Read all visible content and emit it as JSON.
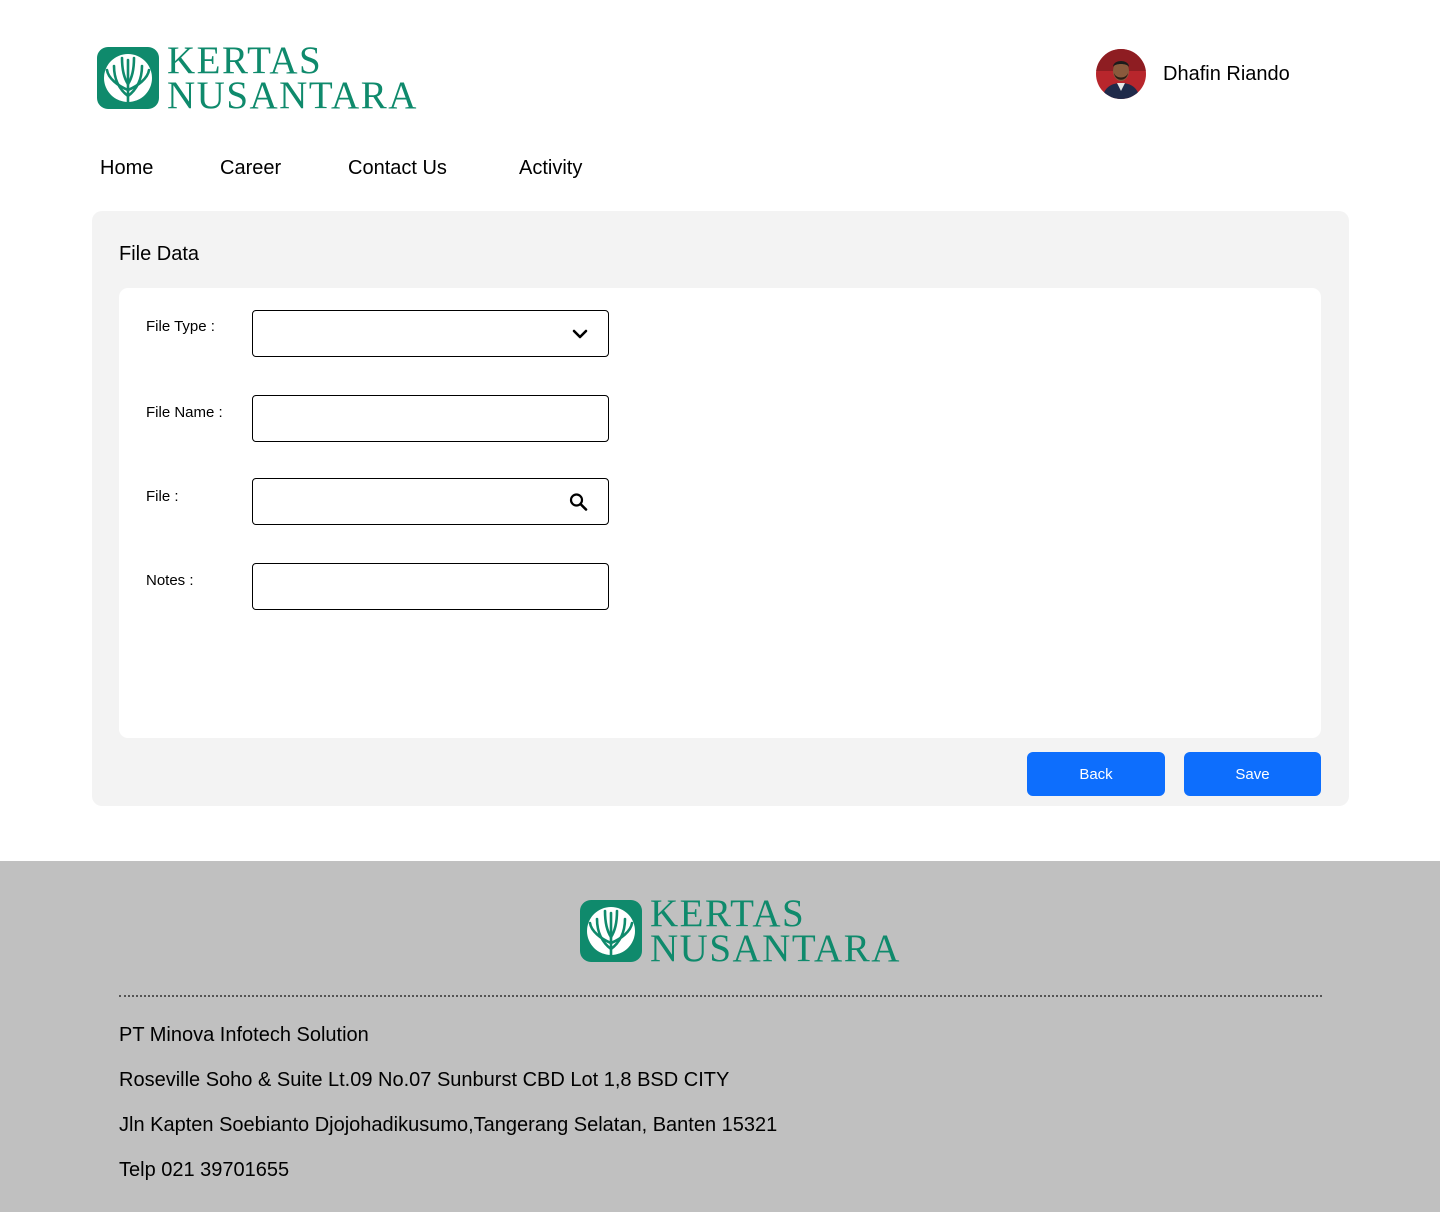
{
  "brand": {
    "line1": "KERTAS",
    "line2": "NUSANTARA",
    "color": "#0f8a6c"
  },
  "user": {
    "name": "Dhafin Riando"
  },
  "nav": {
    "items": [
      "Home",
      "Career",
      "Contact Us",
      "Activity"
    ]
  },
  "form": {
    "title": "File Data",
    "file_type_label": "File Type :",
    "file_type_value": "",
    "file_name_label": "File Name :",
    "file_name_value": "",
    "file_label": "File :",
    "file_value": "",
    "notes_label": "Notes :",
    "notes_value": "",
    "back_label": "Back",
    "save_label": "Save",
    "button_color": "#0d6efd"
  },
  "footer": {
    "company": "PT Minova Infotech Solution",
    "address1": "Roseville Soho & Suite Lt.09 No.07 Sunburst CBD Lot 1,8 BSD CITY",
    "address2": "Jln Kapten Soebianto Djojohadikusumo,Tangerang Selatan, Banten 15321",
    "phone": "Telp 021 39701655"
  }
}
